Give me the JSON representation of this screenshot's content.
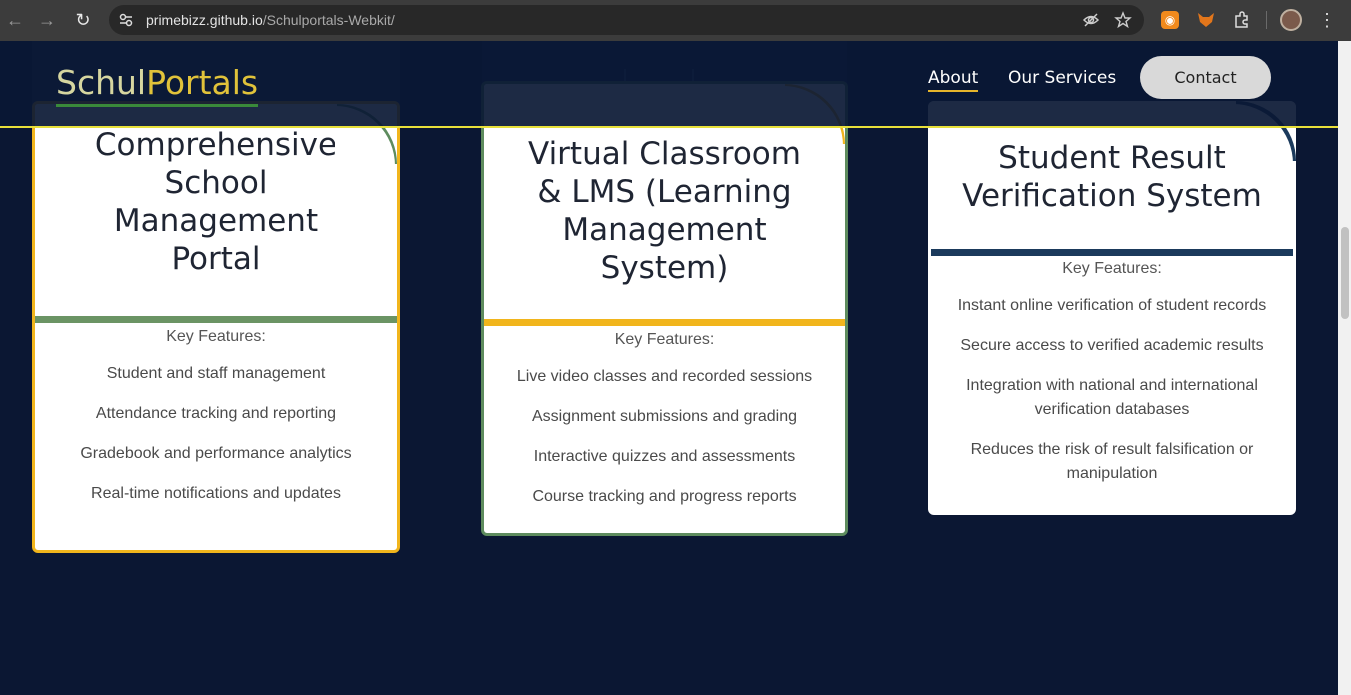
{
  "browser": {
    "url_host": "primebizz.github.io",
    "url_path": "/Schulportals-Webkit/"
  },
  "site": {
    "logo_part1": "Schul",
    "logo_part2": "Portals",
    "nav": [
      "About",
      "Our Services"
    ],
    "contact_label": "Contact"
  },
  "cards": [
    {
      "title_lines": [
        "Comprehensive",
        "School",
        "Management",
        "Portal"
      ],
      "key_features_label": "Key Features:",
      "features": [
        "Student and staff management",
        "Attendance tracking and reporting",
        "Gradebook and performance analytics",
        "Real-time notifications and updates"
      ],
      "band_color": "#6b9464",
      "border_color": "#f1b51c"
    },
    {
      "title_lines": [
        "Virtual Classroom",
        "& LMS (Learning",
        "Management",
        "System)"
      ],
      "key_features_label": "Key Features:",
      "features": [
        "Live video classes and recorded sessions",
        "Assignment submissions and grading",
        "Interactive quizzes and assessments",
        "Course tracking and progress reports"
      ],
      "band_color": "#f1b51c",
      "border_color": "#5e8c5e"
    },
    {
      "title_lines": [
        "Student Result",
        "Verification System"
      ],
      "key_features_label": "Key Features:",
      "features": [
        "Instant online verification of student records",
        "Secure access to verified academic results",
        "Integration with national and international verification databases",
        "Reduces the risk of result falsification or manipulation"
      ],
      "band_color": "#1b3a5c",
      "border_color": ""
    }
  ]
}
